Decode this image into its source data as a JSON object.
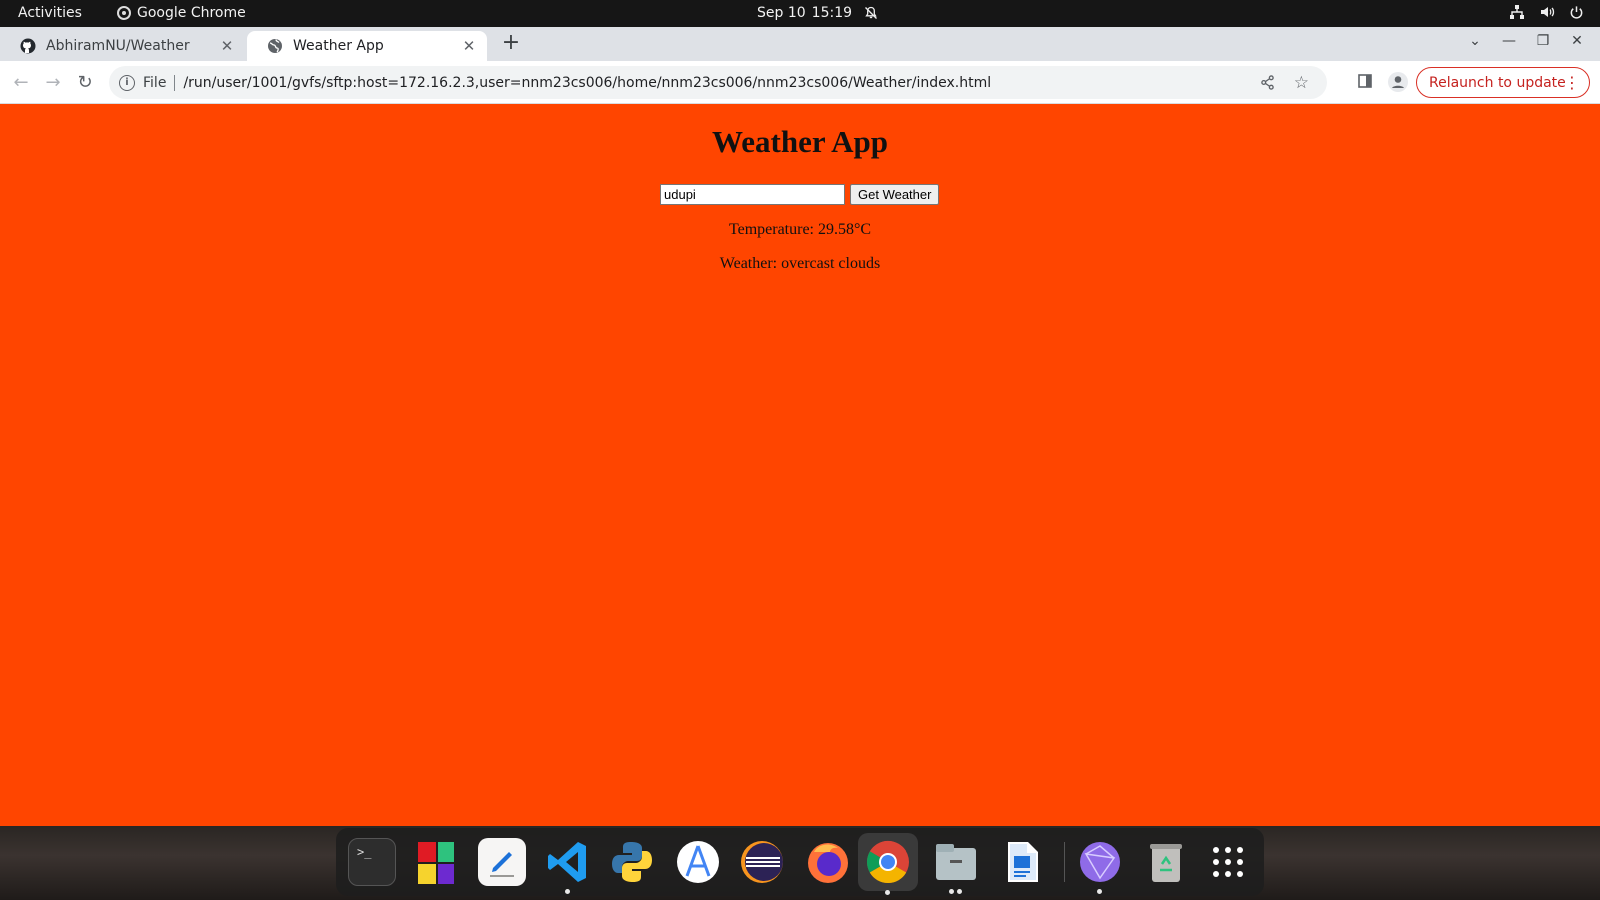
{
  "topbar": {
    "activities": "Activities",
    "app_name": "Google Chrome",
    "date": "Sep 10",
    "time": "15:19"
  },
  "browser": {
    "tabs": [
      {
        "title": "AbhiramNU/Weather",
        "icon": "github-icon",
        "active": false
      },
      {
        "title": "Weather App",
        "icon": "globe-icon",
        "active": true
      }
    ],
    "url_scheme": "File",
    "url": "/run/user/1001/gvfs/sftp:host=172.16.2.3,user=nnm23cs006/home/nnm23cs006/nnm23cs006/Weather/index.html",
    "relaunch_label": "Relaunch to update"
  },
  "page": {
    "title": "Weather App",
    "city_input_value": "udupi",
    "button_label": "Get Weather",
    "temperature_text": "Temperature: 29.58°C",
    "weather_text": "Weather: overcast clouds",
    "background_color": "#ff4500"
  },
  "dock": {
    "items": [
      {
        "icon": "terminal-icon"
      },
      {
        "icon": "software-center-icon"
      },
      {
        "icon": "text-editor-icon"
      },
      {
        "icon": "vscode-icon"
      },
      {
        "icon": "python-icon"
      },
      {
        "icon": "android-studio-icon"
      },
      {
        "icon": "eclipse-icon"
      },
      {
        "icon": "firefox-icon"
      },
      {
        "icon": "chrome-icon"
      },
      {
        "icon": "files-icon"
      },
      {
        "icon": "document-viewer-icon"
      },
      {
        "icon": "network-app-icon"
      },
      {
        "icon": "trash-icon"
      },
      {
        "icon": "app-grid-icon"
      }
    ]
  }
}
